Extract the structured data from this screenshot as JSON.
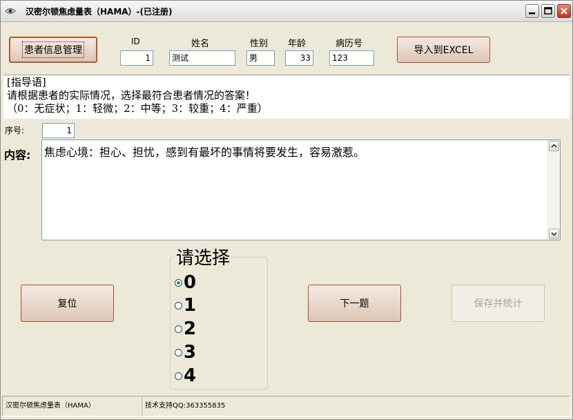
{
  "window": {
    "title": "汉密尔顿焦虑量表（HAMA）-(已注册)",
    "icon": "app-icon",
    "controls": [
      "minimize-icon",
      "maximize-icon",
      "close-icon"
    ]
  },
  "patient": {
    "manage_button": "患者信息管理",
    "id_label": "ID",
    "id_value": "1",
    "name_label": "姓名",
    "name_value": "测试",
    "gender_label": "性别",
    "gender_value": "男",
    "age_label": "年龄",
    "age_value": "33",
    "record_label": "病历号",
    "record_value": "123",
    "export_button": "导入到EXCEL"
  },
  "instructions": {
    "line1": "[指导语]",
    "line2": "请根据患者的实际情况，选择最符合患者情况的答案！",
    "line3": "（0：无症状；1：轻微；2：中等；3：较重；4：严重）"
  },
  "question": {
    "seq_label": "序号:",
    "seq_value": "1",
    "content_label": "内容:",
    "content_text": "焦虑心境：担心、担忧，感到有最坏的事情将要发生，容易激惹。"
  },
  "choices": {
    "title": "请选择",
    "options": [
      "0",
      "1",
      "2",
      "3",
      "4"
    ],
    "selected": "0"
  },
  "buttons": {
    "reset": "复位",
    "next": "下一题",
    "save": "保存并统计"
  },
  "status": {
    "left": "汉密尔顿焦虑量表（HAMA）",
    "right": "技术支持QQ:363355835"
  },
  "colors": {
    "window_bg": "#ece9d8",
    "button_border": "#a0522d",
    "field_border": "#7f9db9"
  }
}
